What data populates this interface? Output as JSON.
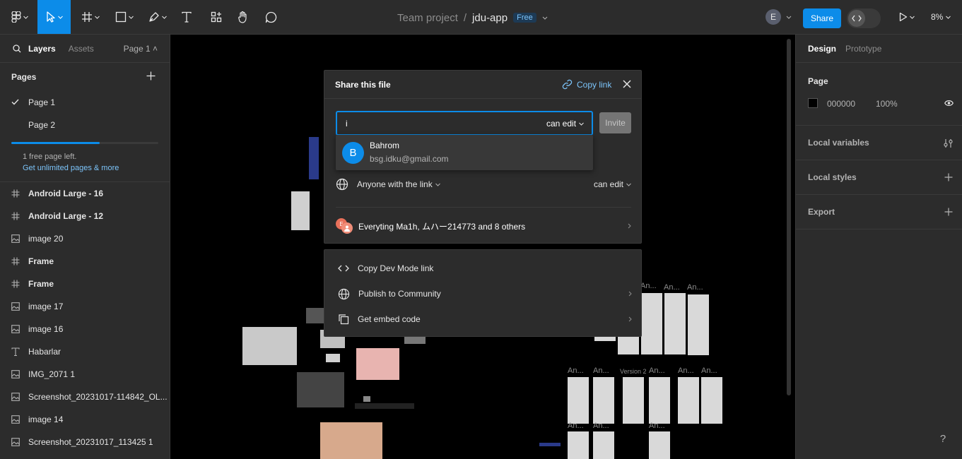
{
  "toolbar": {
    "team": "Team project",
    "separator": "/",
    "file_name": "jdu-app",
    "plan_badge": "Free",
    "avatar_initial": "E",
    "share_label": "Share",
    "zoom": "8%"
  },
  "left_panel": {
    "tabs": [
      "Layers",
      "Assets"
    ],
    "page_selector": "Page 1",
    "pages_title": "Pages",
    "pages": [
      {
        "label": "Page 1",
        "selected": true
      },
      {
        "label": "Page 2",
        "selected": false
      }
    ],
    "free_pages_progress": 0.6,
    "free_text": "1 free page left.",
    "upgrade_link": "Get unlimited pages & more",
    "layers": [
      {
        "label": "Android Large - 16",
        "icon": "frame-icon",
        "bold": true
      },
      {
        "label": "Android Large - 12",
        "icon": "frame-icon",
        "bold": true
      },
      {
        "label": "image 20",
        "icon": "image-icon",
        "bold": false
      },
      {
        "label": "Frame",
        "icon": "frame-icon",
        "bold": true
      },
      {
        "label": "Frame",
        "icon": "frame-icon",
        "bold": true
      },
      {
        "label": "image 17",
        "icon": "image-icon",
        "bold": false
      },
      {
        "label": "image 16",
        "icon": "image-icon",
        "bold": false
      },
      {
        "label": "Habarlar",
        "icon": "text-icon",
        "bold": false
      },
      {
        "label": "IMG_2071 1",
        "icon": "image-icon",
        "bold": false
      },
      {
        "label": "Screenshot_20231017-114842_OL...",
        "icon": "image-icon",
        "bold": false
      },
      {
        "label": "image 14",
        "icon": "image-icon",
        "bold": false
      },
      {
        "label": "Screenshot_20231017_113425 1",
        "icon": "image-icon",
        "bold": false
      }
    ]
  },
  "right_panel": {
    "tabs": [
      "Design",
      "Prototype"
    ],
    "page_title": "Page",
    "page_color": "000000",
    "page_opacity": "100%",
    "sections": [
      "Local variables",
      "Local styles",
      "Export"
    ]
  },
  "canvas": {
    "frame_labels": [
      "An...",
      "An...",
      "An...",
      "An...",
      "An...",
      "An...",
      "Version 2",
      "An...",
      "An...",
      "An...",
      "An...",
      "An...",
      "An..."
    ]
  },
  "share_dialog": {
    "title": "Share this file",
    "copy_link": "Copy link",
    "invite_value": "i",
    "invite_permission": "can edit",
    "invite_button": "Invite",
    "suggestion": {
      "initial": "B",
      "name": "Bahrom",
      "email": "bsg.idku@gmail.com"
    },
    "link_access": "Anyone with the link",
    "link_permission": "can edit",
    "people_avatar": "E",
    "people_text": "Everyting Ma1h, ムハー214773 and 8 others"
  },
  "share_menu": {
    "items": [
      "Copy Dev Mode link",
      "Publish to Community",
      "Get embed code"
    ]
  },
  "help": "?"
}
